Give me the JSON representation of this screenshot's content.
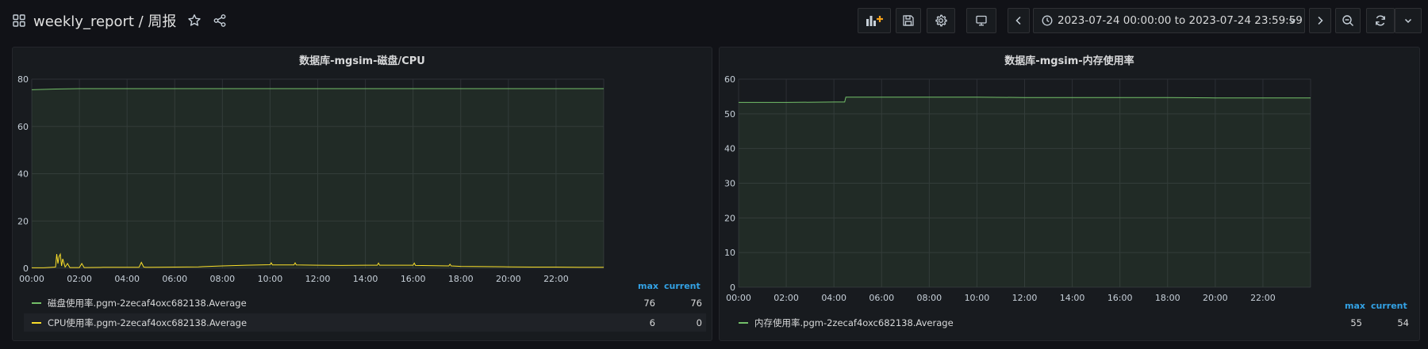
{
  "header": {
    "title": "weekly_report / 周报",
    "time_range": "2023-07-24 00:00:00 to 2023-07-24 23:59:59"
  },
  "icons": {
    "dashboard": "grid-icon",
    "star": "star-icon",
    "share": "share-icon",
    "add_panel": "add-panel-icon",
    "save": "save-icon",
    "settings": "gear-icon",
    "tv": "monitor-icon",
    "back": "chevron-left-icon",
    "clock": "clock-icon",
    "caret": "chevron-down-icon",
    "forward": "chevron-right-icon",
    "zoom_out": "zoom-out-icon",
    "refresh": "refresh-icon",
    "refresh_caret": "chevron-down-icon"
  },
  "colors": {
    "green": "#73bf69",
    "yellow": "#fade2a",
    "legend_header": "#33a2e5"
  },
  "panels": [
    {
      "title": "数据库-mgsim-磁盘/CPU",
      "legend_headers": [
        "max",
        "current"
      ],
      "legend": [
        {
          "name": "磁盘使用率.pgm-2zecaf4oxc682138.Average",
          "max": "76",
          "current": "76"
        },
        {
          "name": "CPU使用率.pgm-2zecaf4oxc682138.Average",
          "max": "6",
          "current": "0"
        }
      ]
    },
    {
      "title": "数据库-mgsim-内存使用率",
      "legend_headers": [
        "max",
        "current"
      ],
      "legend": [
        {
          "name": "内存使用率.pgm-2zecaf4oxc682138.Average",
          "max": "55",
          "current": "54"
        }
      ]
    }
  ],
  "chart_data": [
    {
      "type": "line",
      "title": "数据库-mgsim-磁盘/CPU",
      "x_ticks": [
        "00:00",
        "02:00",
        "04:00",
        "06:00",
        "08:00",
        "10:00",
        "12:00",
        "14:00",
        "16:00",
        "18:00",
        "20:00",
        "22:00"
      ],
      "y_ticks": [
        0,
        20,
        40,
        60,
        80
      ],
      "xlim": [
        0,
        24
      ],
      "ylim": [
        0,
        80
      ],
      "grid": true,
      "series": [
        {
          "name": "磁盘使用率.pgm-2zecaf4oxc682138.Average",
          "color": "#73bf69",
          "fill": true,
          "x": [
            0,
            1,
            2,
            4,
            6,
            8,
            10,
            12,
            14,
            16,
            18,
            20,
            22,
            24
          ],
          "y": [
            75.5,
            75.8,
            76,
            76,
            76,
            76,
            76,
            76,
            76,
            76,
            76,
            76,
            76,
            76
          ]
        },
        {
          "name": "CPU使用率.pgm-2zecaf4oxc682138.Average",
          "color": "#fade2a",
          "fill": false,
          "x": [
            0,
            0.5,
            1.0,
            1.05,
            1.1,
            1.15,
            1.2,
            1.25,
            1.3,
            1.4,
            1.5,
            1.6,
            2.0,
            2.1,
            2.2,
            3.0,
            4.5,
            4.6,
            4.7,
            4.8,
            5.0,
            6.0,
            7.0,
            8.0,
            9.0,
            10.0,
            10.05,
            10.1,
            11.0,
            11.05,
            11.1,
            12.0,
            13.0,
            14.0,
            14.5,
            14.55,
            14.6,
            16.0,
            16.05,
            16.1,
            17.5,
            17.55,
            17.6,
            18.0,
            19.0,
            20.0,
            21.0,
            22.0,
            23.0,
            24.0
          ],
          "y": [
            0.2,
            0.2,
            0.5,
            6,
            2,
            5,
            6,
            1,
            4,
            0.5,
            2,
            0.3,
            0.3,
            2,
            0.3,
            0.4,
            0.4,
            2.5,
            0.5,
            0.4,
            0.4,
            0.5,
            0.6,
            1.0,
            1.3,
            1.5,
            2.3,
            1.4,
            1.4,
            2.3,
            1.4,
            1.3,
            1.2,
            1.3,
            1.3,
            2.2,
            1.3,
            1.3,
            2.2,
            1.2,
            1.0,
            1.7,
            1.0,
            0.8,
            0.7,
            0.6,
            0.5,
            0.5,
            0.4,
            0.4
          ]
        }
      ]
    },
    {
      "type": "line",
      "title": "数据库-mgsim-内存使用率",
      "x_ticks": [
        "00:00",
        "02:00",
        "04:00",
        "06:00",
        "08:00",
        "10:00",
        "12:00",
        "14:00",
        "16:00",
        "18:00",
        "20:00",
        "22:00"
      ],
      "y_ticks": [
        0,
        10,
        20,
        30,
        40,
        50,
        60
      ],
      "xlim": [
        0,
        24
      ],
      "ylim": [
        0,
        60
      ],
      "grid": true,
      "series": [
        {
          "name": "内存使用率.pgm-2zecaf4oxc682138.Average",
          "color": "#73bf69",
          "fill": true,
          "x": [
            0,
            2,
            4,
            4.45,
            4.5,
            6,
            8,
            10,
            12,
            14,
            16,
            18,
            20,
            22,
            24
          ],
          "y": [
            53.3,
            53.3,
            53.4,
            53.4,
            54.8,
            54.8,
            54.8,
            54.8,
            54.7,
            54.7,
            54.7,
            54.7,
            54.6,
            54.6,
            54.6
          ]
        }
      ]
    }
  ]
}
